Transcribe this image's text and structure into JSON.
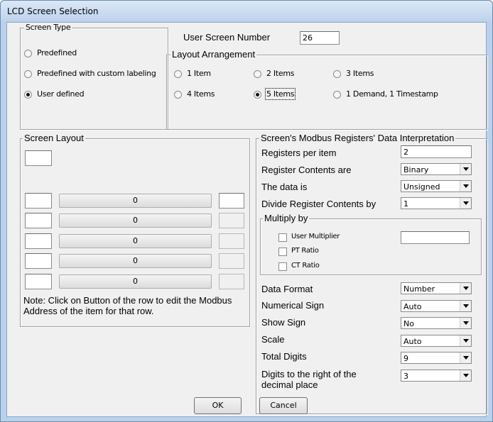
{
  "window": {
    "title": "LCD Screen Selection"
  },
  "screen_type": {
    "legend": "Screen Type",
    "options": [
      {
        "label": "Predefined",
        "selected": false
      },
      {
        "label": "Predefined with custom labeling",
        "selected": false
      },
      {
        "label": "User defined",
        "selected": true
      }
    ]
  },
  "user_screen_number": {
    "label": "User Screen Number",
    "value": "26"
  },
  "layout_arrangement": {
    "legend": "Layout Arrangement",
    "options": [
      {
        "label": "1 Item",
        "selected": false
      },
      {
        "label": "2 Items",
        "selected": false
      },
      {
        "label": "3 Items",
        "selected": false
      },
      {
        "label": "4 Items",
        "selected": false
      },
      {
        "label": "5 Items",
        "selected": true
      },
      {
        "label": "1 Demand, 1 Timestamp",
        "selected": false
      }
    ]
  },
  "screen_layout": {
    "legend": "Screen Layout",
    "header_value": "",
    "rows": [
      {
        "left": "",
        "button": "0",
        "right": ""
      },
      {
        "left": "",
        "button": "0",
        "right": ""
      },
      {
        "left": "",
        "button": "0",
        "right": ""
      },
      {
        "left": "",
        "button": "0",
        "right": ""
      },
      {
        "left": "",
        "button": "0",
        "right": ""
      }
    ],
    "note": "Note: Click on Button of the row to edit the Modbus Address of the item for that row."
  },
  "registers": {
    "legend": "Screen's Modbus Registers' Data Interpretation",
    "registers_per_item": {
      "label": "Registers per item",
      "value": "2"
    },
    "register_contents": {
      "label": "Register Contents are",
      "value": "Binary"
    },
    "data_is": {
      "label": "The data is",
      "value": "Unsigned"
    },
    "divide_by": {
      "label": "Divide Register Contents by",
      "value": "1"
    },
    "multiply_by": {
      "legend": "Multiply by",
      "user_multiplier": {
        "label": "User Multiplier",
        "checked": false,
        "value": ""
      },
      "pt_ratio": {
        "label": "PT Ratio",
        "checked": false
      },
      "ct_ratio": {
        "label": "CT Ratio",
        "checked": false
      }
    },
    "data_format": {
      "label": "Data Format",
      "value": "Number"
    },
    "numerical_sign": {
      "label": "Numerical Sign",
      "value": "Auto"
    },
    "show_sign": {
      "label": "Show Sign",
      "value": "No"
    },
    "scale": {
      "label": "Scale",
      "value": "Auto"
    },
    "total_digits": {
      "label": "Total Digits",
      "value": "9"
    },
    "digits_right": {
      "label": "Digits to the right of the decimal place",
      "value": "3"
    }
  },
  "buttons": {
    "ok": "OK",
    "cancel": "Cancel"
  }
}
